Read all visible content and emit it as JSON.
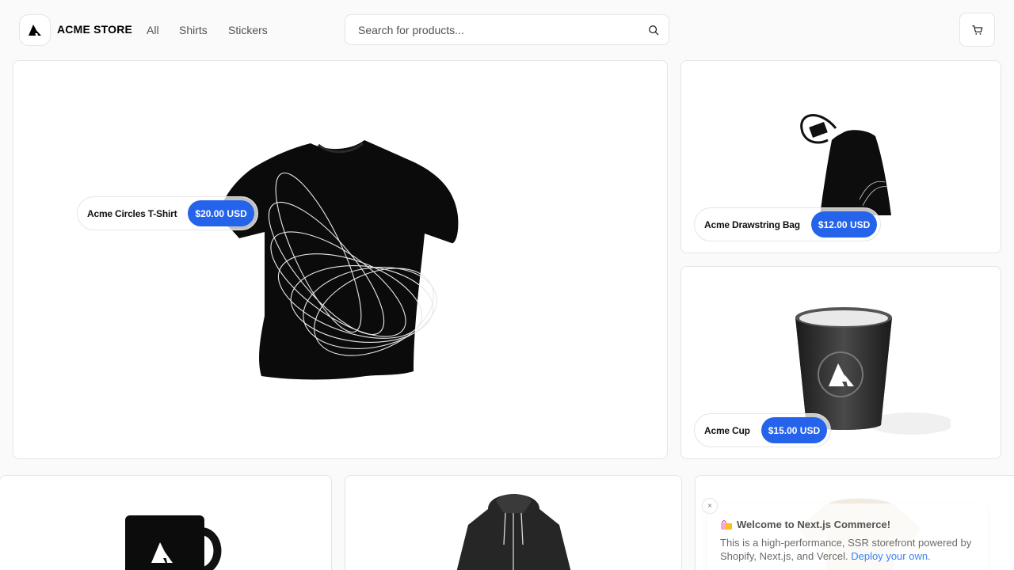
{
  "header": {
    "brand": "ACME STORE",
    "nav": [
      "All",
      "Shirts",
      "Stickers"
    ],
    "search": {
      "placeholder": "Search for products..."
    }
  },
  "products": {
    "featured": {
      "title": "Acme Circles T-Shirt",
      "price": "$20.00 USD"
    },
    "bag": {
      "title": "Acme Drawstring Bag",
      "price": "$12.00 USD"
    },
    "cup": {
      "title": "Acme Cup",
      "price": "$15.00 USD"
    }
  },
  "toast": {
    "title": "Welcome to Next.js Commerce!",
    "body": "This is a high-performance, SSR storefront powered by Shopify, Next.js, and Vercel.",
    "link_text": "Deploy your own.",
    "close": "×"
  },
  "colors": {
    "accent": "#2563eb",
    "link": "#3b82f6"
  },
  "icons": [
    "acme-logo-icon",
    "search-icon",
    "cart-icon",
    "close-icon",
    "shopping-bags-icon"
  ]
}
